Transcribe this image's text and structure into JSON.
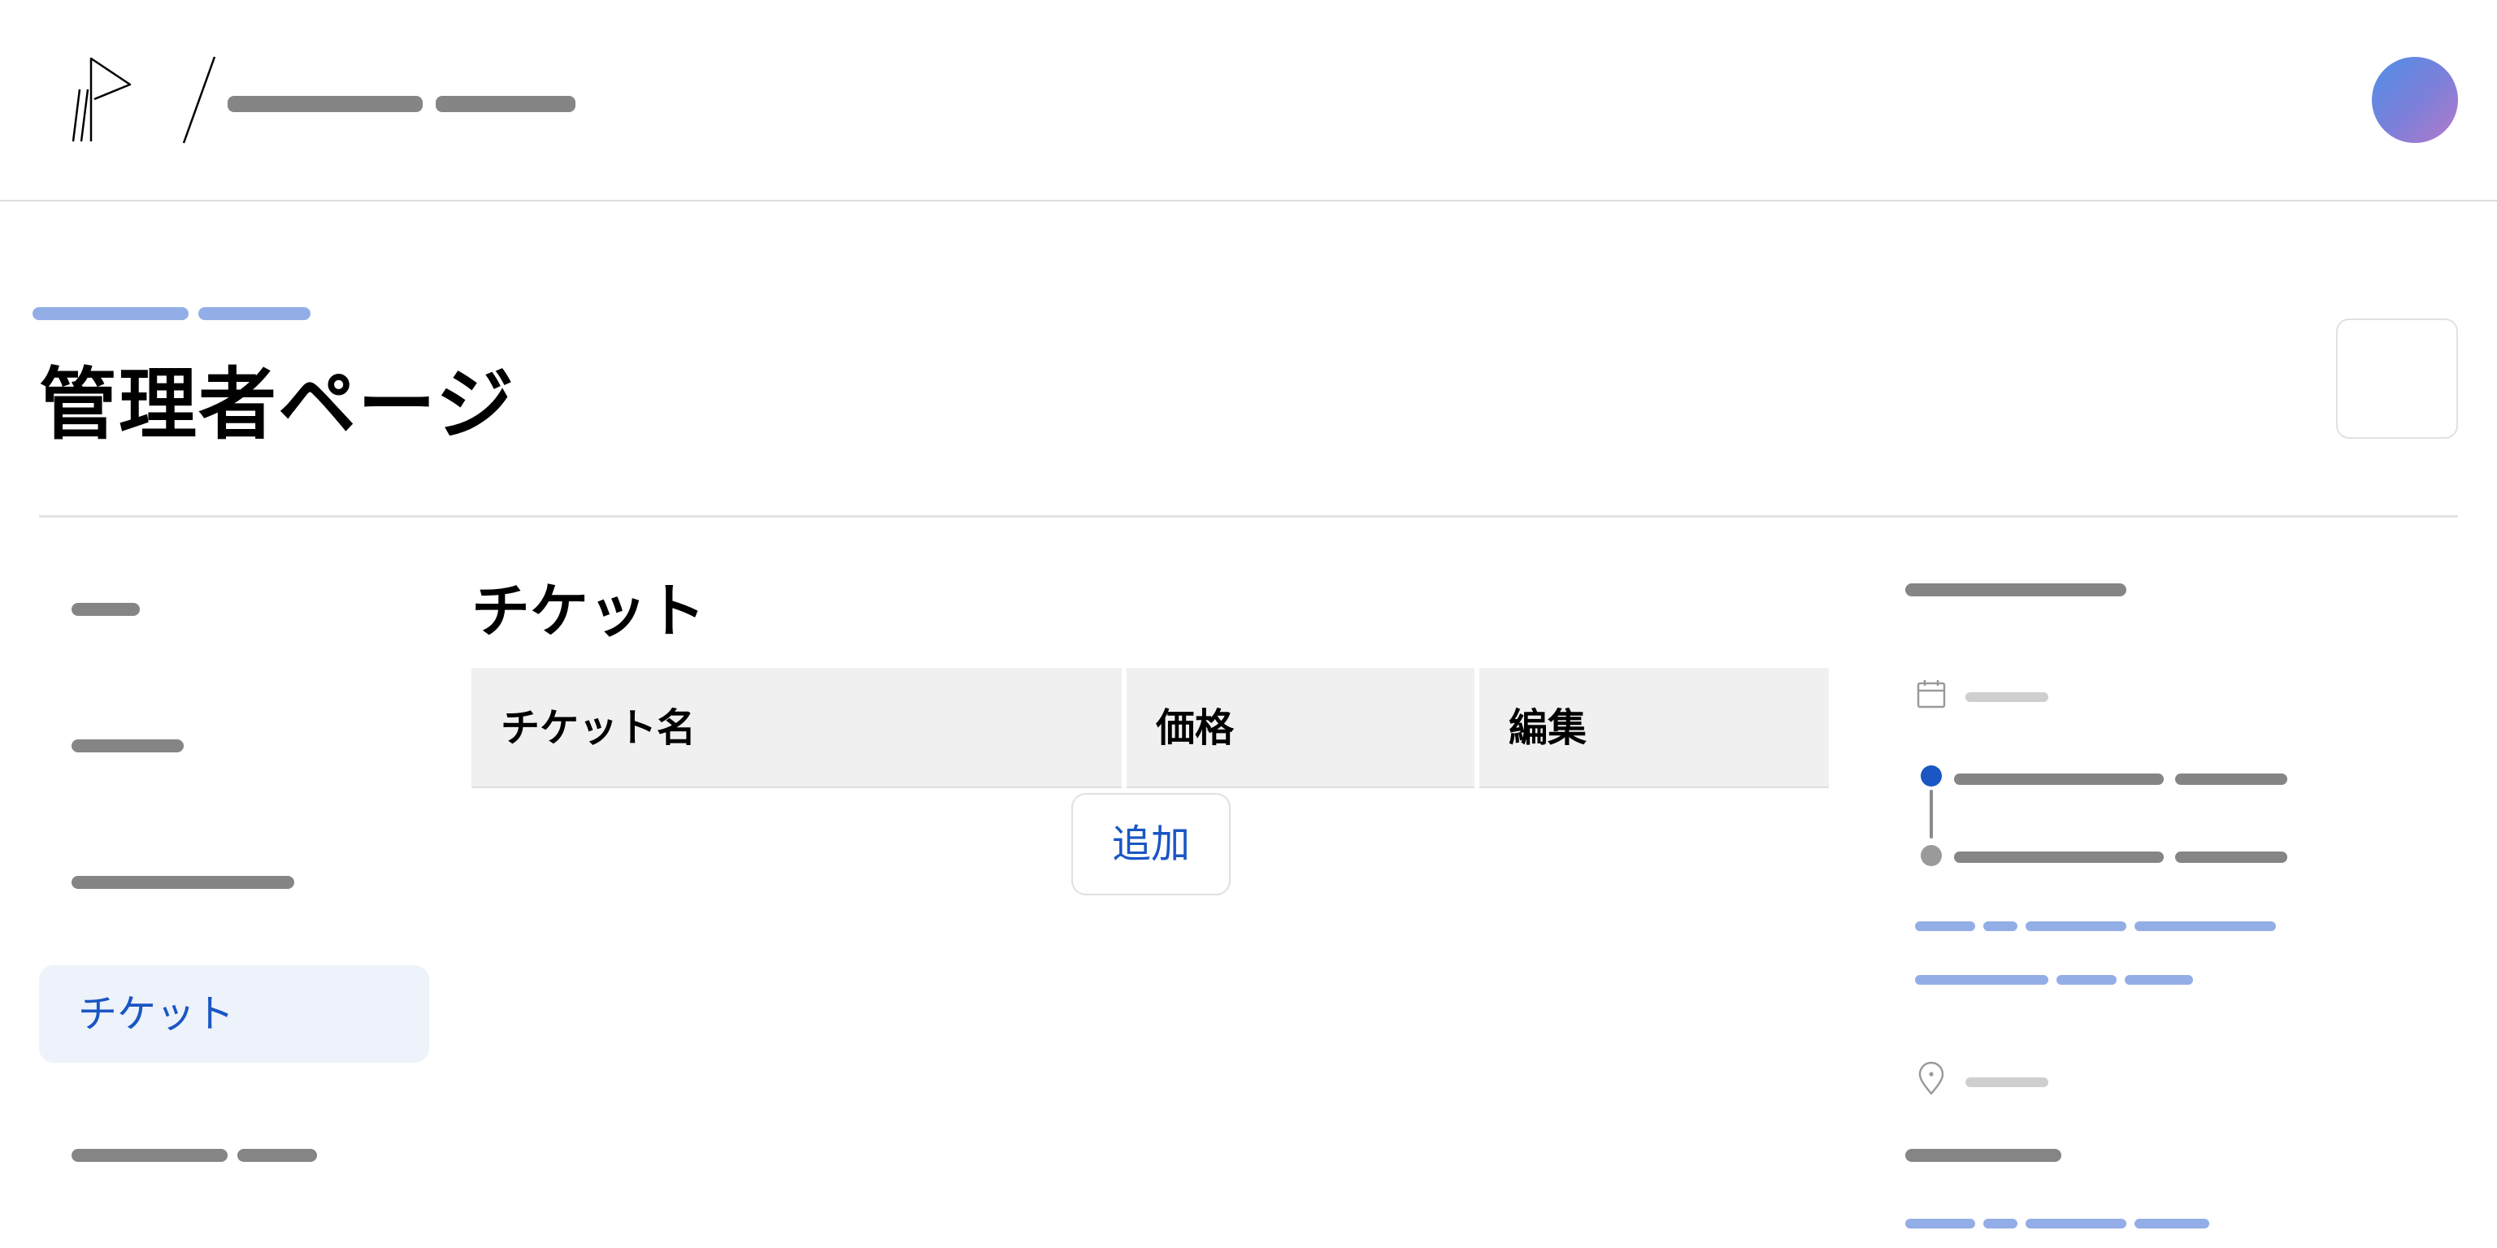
{
  "page": {
    "title": "管理者ページ"
  },
  "sidebar": {
    "active_item": "チケット"
  },
  "main": {
    "section_title": "チケット",
    "table": {
      "columns": [
        "チケット名",
        "価格",
        "編集"
      ],
      "rows": []
    },
    "add_button": "追加"
  },
  "icons": {
    "logo": "flag-logo-icon",
    "separator": "slash-separator",
    "calendar": "calendar-icon",
    "location": "map-pin-icon"
  },
  "colors": {
    "accent": "#1a56c4",
    "placeholder_text": "#858585",
    "placeholder_link": "#93aee6",
    "active_nav_bg": "#edf2fb",
    "table_header_bg": "#f0f0f0"
  }
}
